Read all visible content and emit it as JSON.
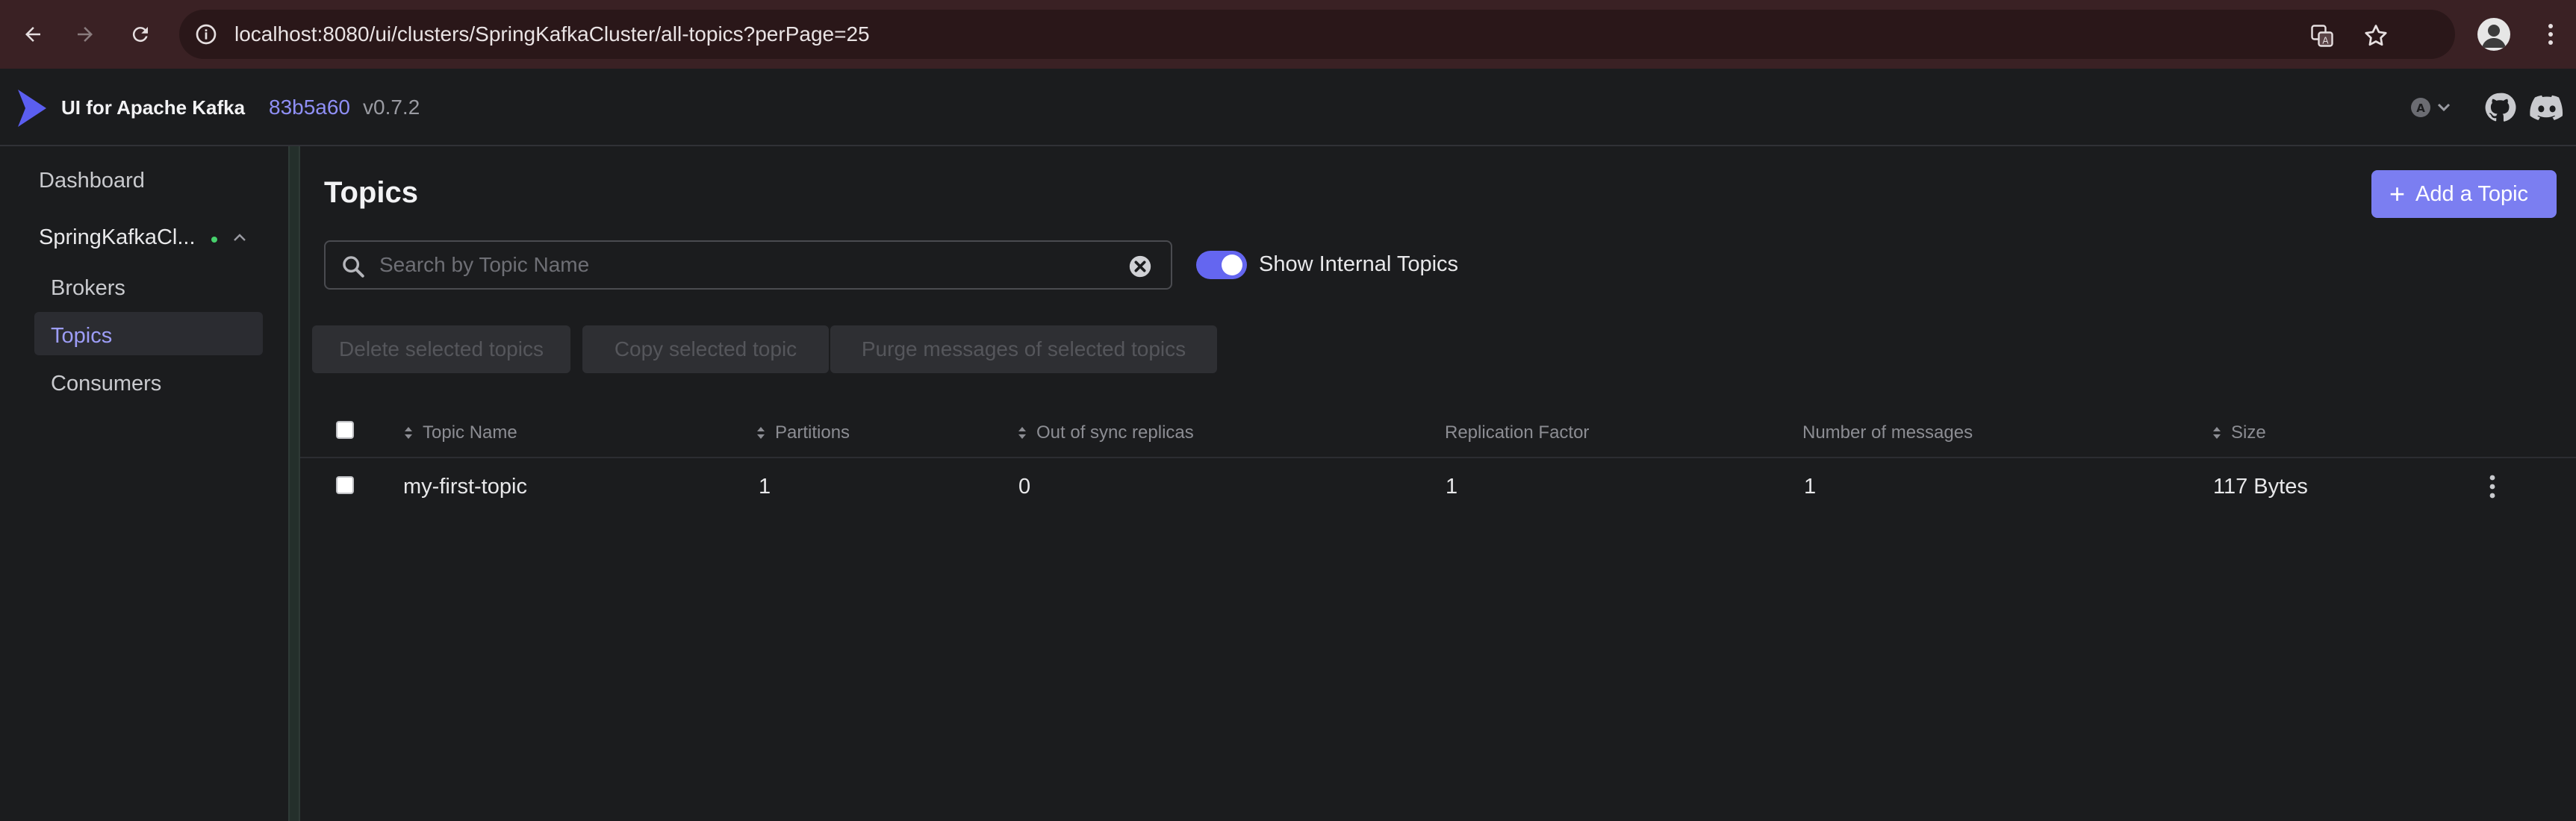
{
  "browser": {
    "url": "localhost:8080/ui/clusters/SpringKafkaCluster/all-topics?perPage=25"
  },
  "app": {
    "brand": "UI for Apache Kafka",
    "commit": "83b5a60",
    "version": "v0.7.2"
  },
  "sidebar": {
    "dashboard": "Dashboard",
    "cluster": "SpringKafkaCl...",
    "items": [
      {
        "label": "Brokers"
      },
      {
        "label": "Topics",
        "active": true
      },
      {
        "label": "Consumers"
      }
    ]
  },
  "main": {
    "title": "Topics",
    "add_button": "Add a Topic",
    "search_placeholder": "Search by Topic Name",
    "toggle_label": "Show Internal Topics",
    "toggle_on": true,
    "bulk_actions": [
      "Delete selected topics",
      "Copy selected topic",
      "Purge messages of selected topics"
    ]
  },
  "table": {
    "columns": [
      "Topic Name",
      "Partitions",
      "Out of sync replicas",
      "Replication Factor",
      "Number of messages",
      "Size"
    ],
    "rows": [
      {
        "name": "my-first-topic",
        "partitions": "1",
        "out_of_sync": "0",
        "replication_factor": "1",
        "messages": "1",
        "size": "117 Bytes"
      }
    ]
  },
  "colors": {
    "accent": "#7b7ef1",
    "active_link": "#9d9df7",
    "online_dot": "#47d16c",
    "browser_bar": "#3a2124"
  }
}
